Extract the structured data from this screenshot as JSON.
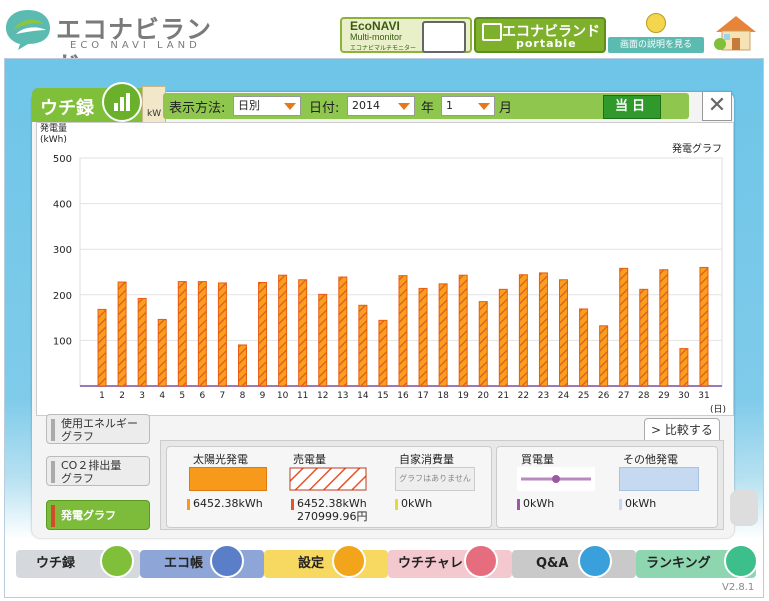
{
  "header": {
    "logo_text": "エコナビランド",
    "logo_sub": "ECO NAVI LAND",
    "econavi_title": "EcoNAVI",
    "econavi_sub": "Multi-monitor",
    "econavi_caption": "エコナビマルチモニター",
    "portable_title": "エコナビランド",
    "portable_sub": "portable",
    "help_label": "画面の説明を見る"
  },
  "tab": {
    "title": "ウチ録",
    "side_tab_label": "kW"
  },
  "controls": {
    "display_label": "表示方法:",
    "display_value": "日別",
    "date_label": "日付:",
    "year_value": "2014",
    "year_unit": "年",
    "month_value": "1",
    "month_unit": "月",
    "today_button": "当日",
    "close_label": "✕"
  },
  "chart_data": {
    "type": "bar",
    "title": "発電グラフ",
    "ylabel": "発電量\n(kWh)",
    "xlabel": "(日)",
    "ylim": [
      0,
      500
    ],
    "yticks": [
      100,
      200,
      300,
      400,
      500
    ],
    "categories": [
      "1",
      "2",
      "3",
      "4",
      "5",
      "6",
      "7",
      "8",
      "9",
      "10",
      "11",
      "12",
      "13",
      "14",
      "15",
      "16",
      "17",
      "18",
      "19",
      "20",
      "21",
      "22",
      "23",
      "24",
      "25",
      "26",
      "27",
      "28",
      "29",
      "30",
      "31"
    ],
    "values": [
      168,
      228,
      192,
      146,
      229,
      229,
      226,
      90,
      227,
      243,
      233,
      201,
      239,
      177,
      144,
      242,
      214,
      224,
      243,
      185,
      212,
      244,
      248,
      233,
      169,
      132,
      258,
      212,
      255,
      82,
      260
    ],
    "grid": true,
    "bar_color": "#f7a11a",
    "bar_stroke": "#e85c12",
    "hatch_color": "#e8532a"
  },
  "sidebar": {
    "buttons": [
      {
        "label": "使用エネルギーグラフ",
        "line1": "使用エネルギー",
        "line2": "グラフ"
      },
      {
        "label": "CO２排出量グラフ",
        "line1": "CO２排出量",
        "line2": "グラフ"
      },
      {
        "label": "発電グラフ",
        "line1": "発電グラフ",
        "line2": ""
      }
    ]
  },
  "compare_button": "> 比較する",
  "legend": {
    "solar_label": "太陽光発電",
    "solar_value": "6452.38kWh",
    "sold_label": "売電量",
    "sold_value": "6452.38kWh",
    "sold_yen": "270999.96円",
    "self_label": "自家消費量",
    "self_note": "グラフはありません",
    "self_value": "0kWh",
    "buy_label": "買電量",
    "buy_value": "0kWh",
    "other_label": "その他発電",
    "other_value": "0kWh",
    "colors": {
      "solar": "#f79a1c",
      "sold": "#e8532a",
      "buy": "#9b5aa0",
      "other": "#c5d9f0",
      "self": "#e5d83a"
    }
  },
  "nav": {
    "items": [
      "ウチ録",
      "エコ帳",
      "設定",
      "ウチチャレ",
      "Q&A",
      "ランキング"
    ],
    "version": "V2.8.1"
  }
}
